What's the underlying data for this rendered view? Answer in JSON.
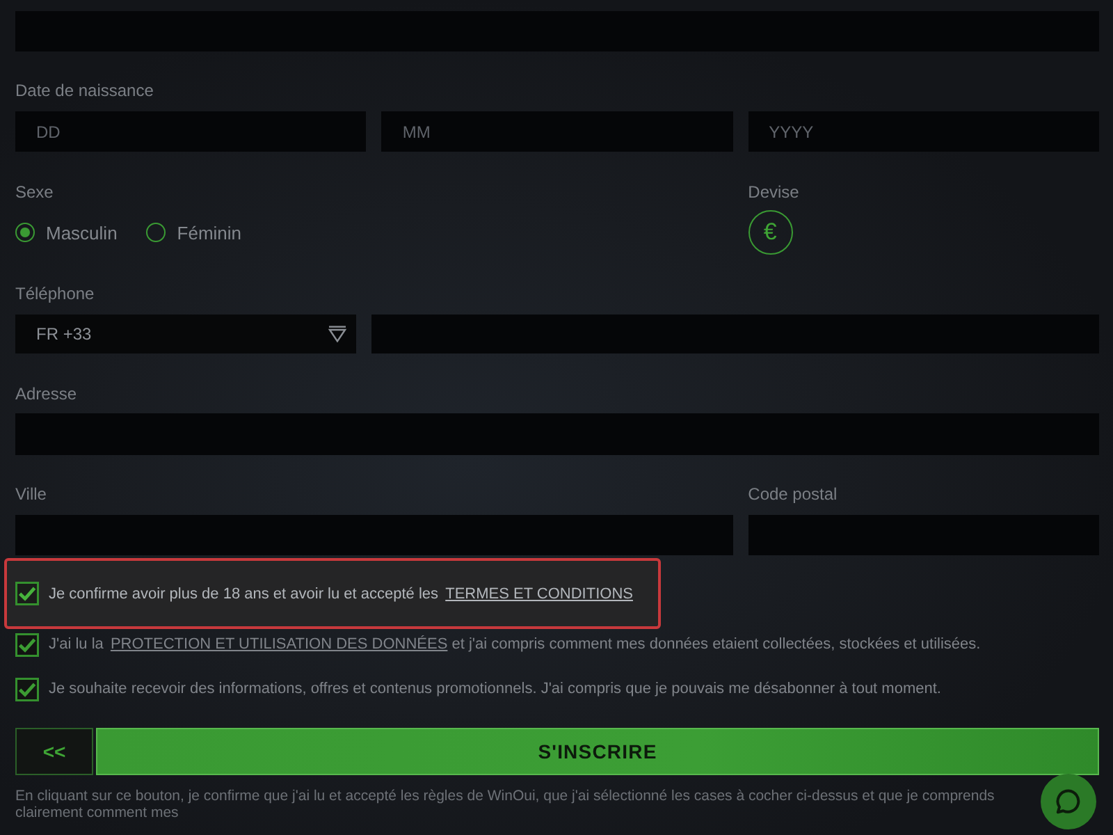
{
  "form": {
    "birth_date": {
      "label": "Date de naissance",
      "fields": [
        {
          "placeholder": "DD"
        },
        {
          "placeholder": "MM"
        },
        {
          "placeholder": "YYYY"
        }
      ]
    },
    "sex": {
      "label": "Sexe",
      "options": [
        {
          "label": "Masculin",
          "selected": true
        },
        {
          "label": "Féminin",
          "selected": false
        }
      ]
    },
    "currency": {
      "label": "Devise",
      "symbol": "€",
      "selected": true
    },
    "phone": {
      "label": "Téléphone",
      "country_code": "FR +33"
    },
    "address": {
      "label": "Adresse"
    },
    "city": {
      "label": "Ville"
    },
    "postal_code": {
      "label": "Code postal"
    },
    "consents": [
      {
        "text_before": "Je confirme avoir plus de 18 ans et avoir lu et accepté les ",
        "link": "TERMES ET CONDITIONS",
        "checked": true,
        "highlighted": true
      },
      {
        "text_before": "J'ai lu la ",
        "link": "PROTECTION ET UTILISATION DES DONNÉES",
        "text_after": " et j'ai compris comment mes données etaient collectées, stockées et utilisées.",
        "checked": true,
        "highlighted": false
      },
      {
        "text_before": "Je souhaite recevoir des informations, offres et contenus promotionnels. J'ai compris que je pouvais me désabonner à tout moment.",
        "checked": true,
        "highlighted": false
      }
    ],
    "back_button": "<<",
    "submit_button": "S'INSCRIRE",
    "disclaimer": "En cliquant sur ce bouton, je confirme que j'ai lu et accepté les règles de WinOui, que j'ai sélectionné les cases à cocher ci-dessus et que je comprends clairement comment mes"
  }
}
